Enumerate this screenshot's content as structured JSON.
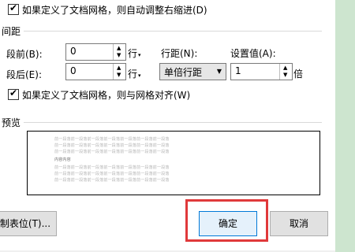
{
  "checkbox_right_indent": {
    "label": "如果定义了文档网格，则自动调整右缩进(D)",
    "checked": true
  },
  "spacing_section": {
    "title": "间距",
    "before": {
      "label": "段前(B):",
      "value": "0",
      "unit": "行"
    },
    "after": {
      "label": "段后(E):",
      "value": "0",
      "unit": "行"
    },
    "line_spacing": {
      "label": "行距(N):",
      "value": "单倍行距"
    },
    "set_value": {
      "label": "设置值(A):",
      "value": "1",
      "unit": "倍"
    }
  },
  "checkbox_grid_align": {
    "label": "如果定义了文档网格，则与网格对齐(W)",
    "checked": true
  },
  "preview_section": {
    "title": "预览",
    "line_text": "前一段落前一段落前一段落前一段落前一段落前一段落前一段落",
    "current_text": "内容内容"
  },
  "buttons": {
    "tabs": "制表位(T)...",
    "ok": "确定",
    "cancel": "取消"
  },
  "colors": {
    "accent": "#0078d7",
    "highlight": "#e0393b",
    "side": "#cde5cf"
  }
}
